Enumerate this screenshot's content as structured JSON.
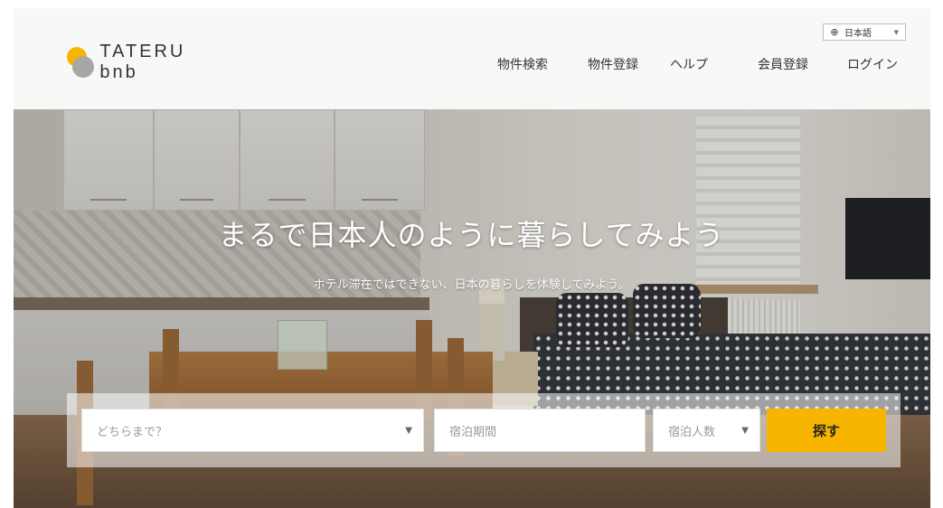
{
  "brand": {
    "name": "TATERU bnb"
  },
  "language": {
    "icon": "globe-icon",
    "label": "日本語",
    "caret_icon": "caret-down-icon"
  },
  "nav": [
    "物件検索",
    "物件登録",
    "ヘルプ",
    "会員登録",
    "ログイン"
  ],
  "hero": {
    "title": "まるで日本人のように暮らしてみよう",
    "subtitle": "ホテル滞在ではできない、日本の暮らしを体験してみよう。"
  },
  "search": {
    "destination_placeholder": "どちらまで？",
    "dates_placeholder": "宿泊期間",
    "guests_placeholder": "宿泊人数",
    "submit_label": "探す",
    "dropdown_icon": "triangle-down-icon"
  },
  "colors": {
    "accent": "#f7b500",
    "logo_gray": "#a7a7a7",
    "text": "#333333"
  }
}
